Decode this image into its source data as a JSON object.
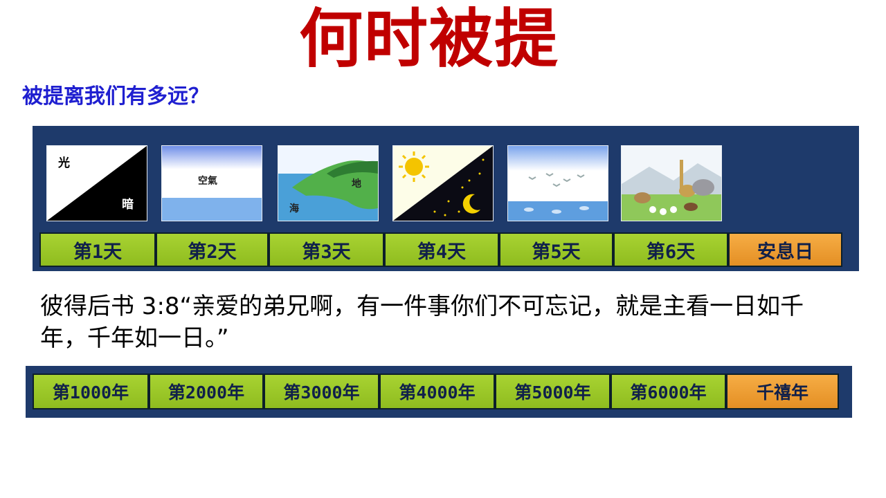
{
  "title": "何时被提",
  "subtitle": "被提离我们有多远？",
  "creation": {
    "images": [
      {
        "icon": "light-dark-icon",
        "labels": [
          "光",
          "暗"
        ]
      },
      {
        "icon": "sky-water-icon",
        "labels": [
          "空氣"
        ]
      },
      {
        "icon": "land-sea-icon",
        "labels": [
          "地",
          "海"
        ]
      },
      {
        "icon": "sun-moon-icon",
        "labels": []
      },
      {
        "icon": "birds-fish-icon",
        "labels": []
      },
      {
        "icon": "animals-icon",
        "labels": []
      }
    ],
    "days": [
      "第1天",
      "第2天",
      "第3天",
      "第4天",
      "第5天",
      "第6天",
      "安息日"
    ]
  },
  "verse": "彼得后书 3:8“亲爱的弟兄啊，有一件事你们不可忘记，就是主看一日如千年，千年如一日。”",
  "millennium": {
    "years": [
      "第1000年",
      "第2000年",
      "第3000年",
      "第4000年",
      "第5000年",
      "第6000年",
      "千禧年"
    ]
  },
  "colors": {
    "title": "#c00000",
    "subtitle": "#1f1fd0",
    "banner": "#1e3a6b",
    "cell": "#99c424",
    "rest": "#ef9d35"
  }
}
